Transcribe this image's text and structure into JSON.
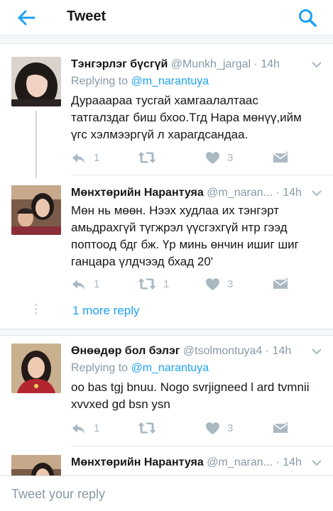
{
  "header": {
    "title": "Tweet",
    "back_icon": "arrow-left-icon",
    "search_icon": "search-icon"
  },
  "colors": {
    "accent": "#1da1f2",
    "muted": "#8899a6",
    "icon": "#aab8c2"
  },
  "tweets": [
    {
      "name": "Тэнгэрлэг бүсгүй",
      "handle": "@Munkh_jargal",
      "sep": "·",
      "time": "14h",
      "replying_prefix": "Replying to",
      "replying_to": "@m_narantuya",
      "text_lines": [
        "Дурааараа тусгай хамгаалалтаас",
        "татгалздаг биш бхоо.Тгд Нара мөнүү,ийм",
        "үгс хэлмээргүй л харагдсандаа."
      ],
      "reply_count": "1",
      "retweet_count": "",
      "like_count": "3"
    },
    {
      "name": "Мөнхтөрийн Нарантуяа",
      "handle": "@m_naran...",
      "sep": "·",
      "time": "14h",
      "text_lines": [
        "Мөн нь мөөн. Нээх худлаа их тэнгэрт",
        "амьдрахгүй түгжрэл үүсгэхгүй нтр гээд",
        "поптоод бдг бж. Үр минь өнчин ишиг шиг",
        "ганцара үлдчээд бхад 20'"
      ],
      "reply_count": "1",
      "retweet_count": "1",
      "like_count": "3"
    },
    {
      "name": "Өнөөдөр бол бэлэг",
      "handle": "@tsolmontuya4",
      "sep": "·",
      "time": "14h",
      "replying_prefix": "Replying to",
      "replying_to": "@m_narantuya",
      "text_lines": [
        "oo bas tgj bnuu. Nogo svrjigneed l ard tvmnii",
        "xvvxed gd bsn ysn"
      ],
      "reply_count": "1",
      "retweet_count": "",
      "like_count": "3"
    },
    {
      "name": "Мөнхтөрийн Нарантуяа",
      "handle": "@m_naran...",
      "sep": "·",
      "time": "14h"
    }
  ],
  "more_replies": "1 more reply",
  "composer": {
    "placeholder": "Tweet your reply"
  }
}
